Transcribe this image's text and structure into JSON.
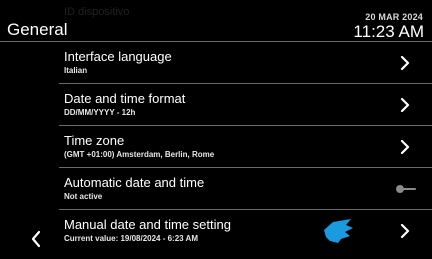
{
  "header": {
    "ghost_text": "ID dispositivo",
    "title": "General",
    "date": "20 MAR 2024",
    "time": "11:23 AM"
  },
  "settings": [
    {
      "label": "Interface language",
      "value": "Italian",
      "control": "chevron-right-icon"
    },
    {
      "label": "Date and time format",
      "value": "DD/MM/YYYY - 12h",
      "control": "chevron-right-icon"
    },
    {
      "label": "Time zone",
      "value": "(GMT +01:00) Amsterdam, Berlin, Rome",
      "control": "chevron-right-icon"
    },
    {
      "label": "Automatic date and time",
      "value": "Not active",
      "control": "toggle-off-icon"
    },
    {
      "label": "Manual date and time setting",
      "value": "Current value: 19/08/2024 - 6:23 AM",
      "control": "chevron-right-icon"
    }
  ],
  "nav": {
    "back_icon": "chevron-left-icon"
  },
  "overlay": {
    "icon": "pointing-hand-icon",
    "color": "#1a9be0"
  }
}
